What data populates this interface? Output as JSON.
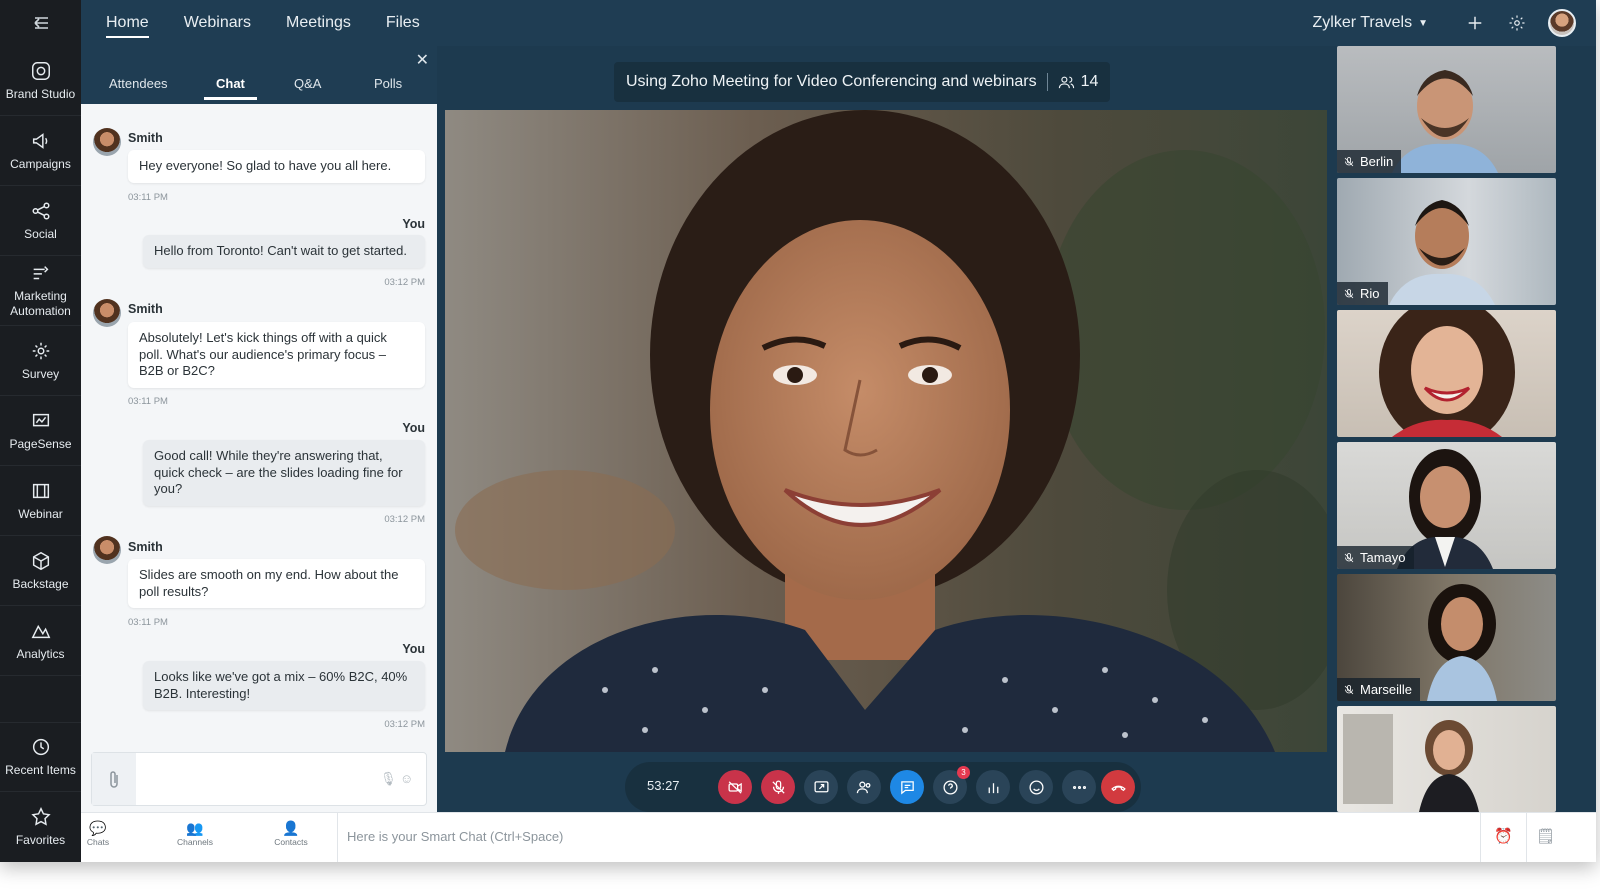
{
  "rail": {
    "items": [
      {
        "label": "Brand Studio",
        "icon": "palette-icon"
      },
      {
        "label": "Campaigns",
        "icon": "megaphone-icon"
      },
      {
        "label": "Social",
        "icon": "share-icon"
      },
      {
        "label": "Marketing Automation",
        "icon": "automation-icon"
      },
      {
        "label": "Survey",
        "icon": "survey-icon"
      },
      {
        "label": "PageSense",
        "icon": "pagesense-icon"
      },
      {
        "label": "Webinar",
        "icon": "webinar-icon"
      },
      {
        "label": "Backstage",
        "icon": "backstage-icon"
      },
      {
        "label": "Analytics",
        "icon": "analytics-icon"
      }
    ],
    "bottom_items": [
      {
        "label": "Recent Items",
        "icon": "history-icon"
      },
      {
        "label": "Favorites",
        "icon": "star-icon"
      }
    ]
  },
  "topbar": {
    "tabs": [
      "Home",
      "Webinars",
      "Meetings",
      "Files"
    ],
    "active_tab": "Home",
    "org_name": "Zylker Travels"
  },
  "chat_panel": {
    "tabs": [
      "Attendees",
      "Chat",
      "Q&A",
      "Polls"
    ],
    "active_tab": "Chat",
    "messages": [
      {
        "sender": "Smith",
        "text": "Hey everyone! So glad to have you all here.",
        "time": "03:11 PM"
      },
      {
        "sender": "You",
        "text": "Hello from Toronto! Can't wait to get started.",
        "time": "03:12 PM"
      },
      {
        "sender": "Smith",
        "text": "Absolutely! Let's kick things off with a quick poll. What's our audience's primary focus – B2B or B2C?",
        "time": "03:11 PM"
      },
      {
        "sender": "You",
        "text": "Good call! While they're answering that, quick check – are the slides loading fine for you?",
        "time": "03:12 PM"
      },
      {
        "sender": "Smith",
        "text": "Slides are smooth on my end. How about the poll results?",
        "time": "03:11 PM"
      },
      {
        "sender": "You",
        "text": "Looks like we've got a mix – 60% B2C, 40% B2B. Interesting!",
        "time": "03:12 PM"
      }
    ],
    "composer_value": ""
  },
  "meeting": {
    "title": "Using Zoho Meeting for Video Conferencing and webinars",
    "participant_count": "14",
    "timer": "53:27",
    "qa_badge": "3",
    "participants": [
      "Berlin",
      "Rio",
      "",
      "Tamayo",
      "Marseille",
      ""
    ]
  },
  "smartbar": {
    "items": [
      "Chats",
      "Channels",
      "Contacts"
    ],
    "placeholder": "Here is your Smart Chat (Ctrl+Space)"
  }
}
